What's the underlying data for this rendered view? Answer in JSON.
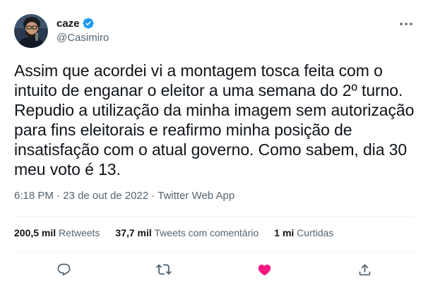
{
  "author": {
    "display_name": "caze",
    "handle": "@Casimiro",
    "verified": true
  },
  "tweet": {
    "text": "Assim que acordei vi a montagem tosca feita com o intuito de enganar o eleitor a uma semana do 2º turno. Repudio a utilização da minha imagem sem autorização para fins eleitorais e reafirmo minha posição de insatisfação com o atual governo. Como sabem, dia 30 meu voto é 13.",
    "time": "6:18 PM",
    "separator": "·",
    "date": "23 de out de 2022",
    "source": "Twitter Web App"
  },
  "stats": {
    "retweets_count": "200,5 mil",
    "retweets_label": "Retweets",
    "quotes_count": "37,7 mil",
    "quotes_label": "Tweets com comentário",
    "likes_count": "1 mi",
    "likes_label": "Curtidas"
  },
  "actions": {
    "reply_icon": "reply-icon",
    "retweet_icon": "retweet-icon",
    "like_icon": "heart-icon",
    "share_icon": "share-icon",
    "liked": true
  },
  "colors": {
    "brand_blue": "#1d9bf0",
    "like_pink": "#f91880",
    "secondary_text": "#536471"
  }
}
